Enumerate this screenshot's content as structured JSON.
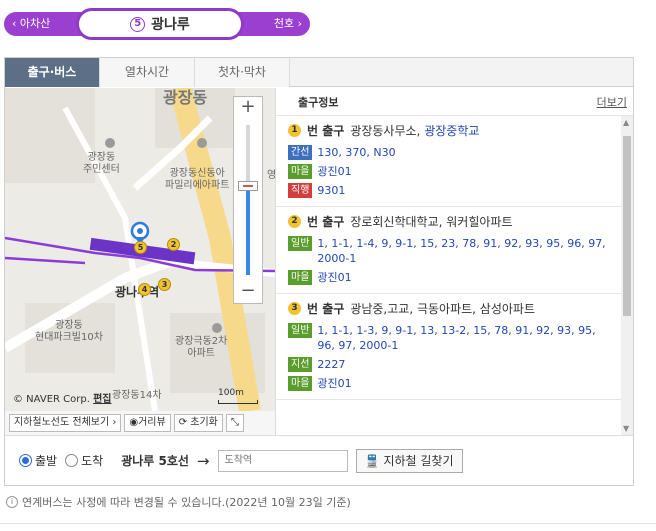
{
  "station_bar": {
    "prev": "‹ 아차산",
    "next": "천호 ›",
    "current_line": "5",
    "current_name": "광나루",
    "line_color": "#8d3ac9"
  },
  "tabs": [
    {
      "label": "출구·버스",
      "active": true
    },
    {
      "label": "열차시간",
      "active": false
    },
    {
      "label": "첫차·막차",
      "active": false
    }
  ],
  "map": {
    "labels": {
      "district": "광장동",
      "center": "광장동\n주민센터",
      "apt1": "광장동신동아\n파밀리에아파트",
      "station": "광나루역",
      "apt2": "광장동\n현대파크빌10차",
      "apt3": "광장극동2차\n아파트",
      "apt4": "광장동14차",
      "right_edge": "영"
    },
    "exit_markers": [
      "2",
      "3",
      "4",
      "5"
    ],
    "scale": "100m",
    "copyright": "© NAVER Corp.",
    "copyright_link": "편집",
    "zoom_in": "+",
    "zoom_out": "−",
    "zoom_level_fraction": 0.59
  },
  "map_tools": {
    "full_view": "지하철노선도 전체보기 ›",
    "street_view": "거리뷰",
    "reset": "초기화"
  },
  "exit_panel": {
    "title": "출구정보",
    "more": "더보기",
    "exits": [
      {
        "num": "1",
        "label": "번 출구",
        "places": "광장동사무소,",
        "place_link": "광장중학교",
        "buses": [
          {
            "type": "간선",
            "kind": "trunk",
            "list": "130, 370, N30"
          },
          {
            "type": "마을",
            "kind": "village",
            "list": "광진01"
          },
          {
            "type": "직행",
            "kind": "direct",
            "list": "9301"
          }
        ]
      },
      {
        "num": "2",
        "label": "번 출구",
        "places": "장로회신학대학교, 워커힐아파트",
        "place_link": "",
        "buses": [
          {
            "type": "일반",
            "kind": "general",
            "list": "1, 1-1, 1-4, 9, 9-1, 15, 23, 78, 91, 92, 93, 95, 96, 97, 2000-1"
          },
          {
            "type": "마을",
            "kind": "village",
            "list": "광진01"
          }
        ]
      },
      {
        "num": "3",
        "label": "번 출구",
        "places": "광남중,고교, 극동아파트, 삼성아파트",
        "place_link": "",
        "buses": [
          {
            "type": "일반",
            "kind": "general",
            "list": "1, 1-1, 1-3, 9, 9-1, 13, 13-2, 15, 78, 91, 92, 93, 95, 96, 97, 2000-1"
          },
          {
            "type": "지선",
            "kind": "branch",
            "list": "2227"
          },
          {
            "type": "마을",
            "kind": "village",
            "list": "광진01"
          }
        ]
      }
    ]
  },
  "route": {
    "depart": "출발",
    "arrive": "도착",
    "from": "광나루 5호선",
    "arrow": "→",
    "dest_placeholder": "도착역",
    "search": "지하철 길찾기"
  },
  "notice": "연계버스는 사정에 따라 변경될 수 있습니다.(2022년 10월 23일 기준)"
}
